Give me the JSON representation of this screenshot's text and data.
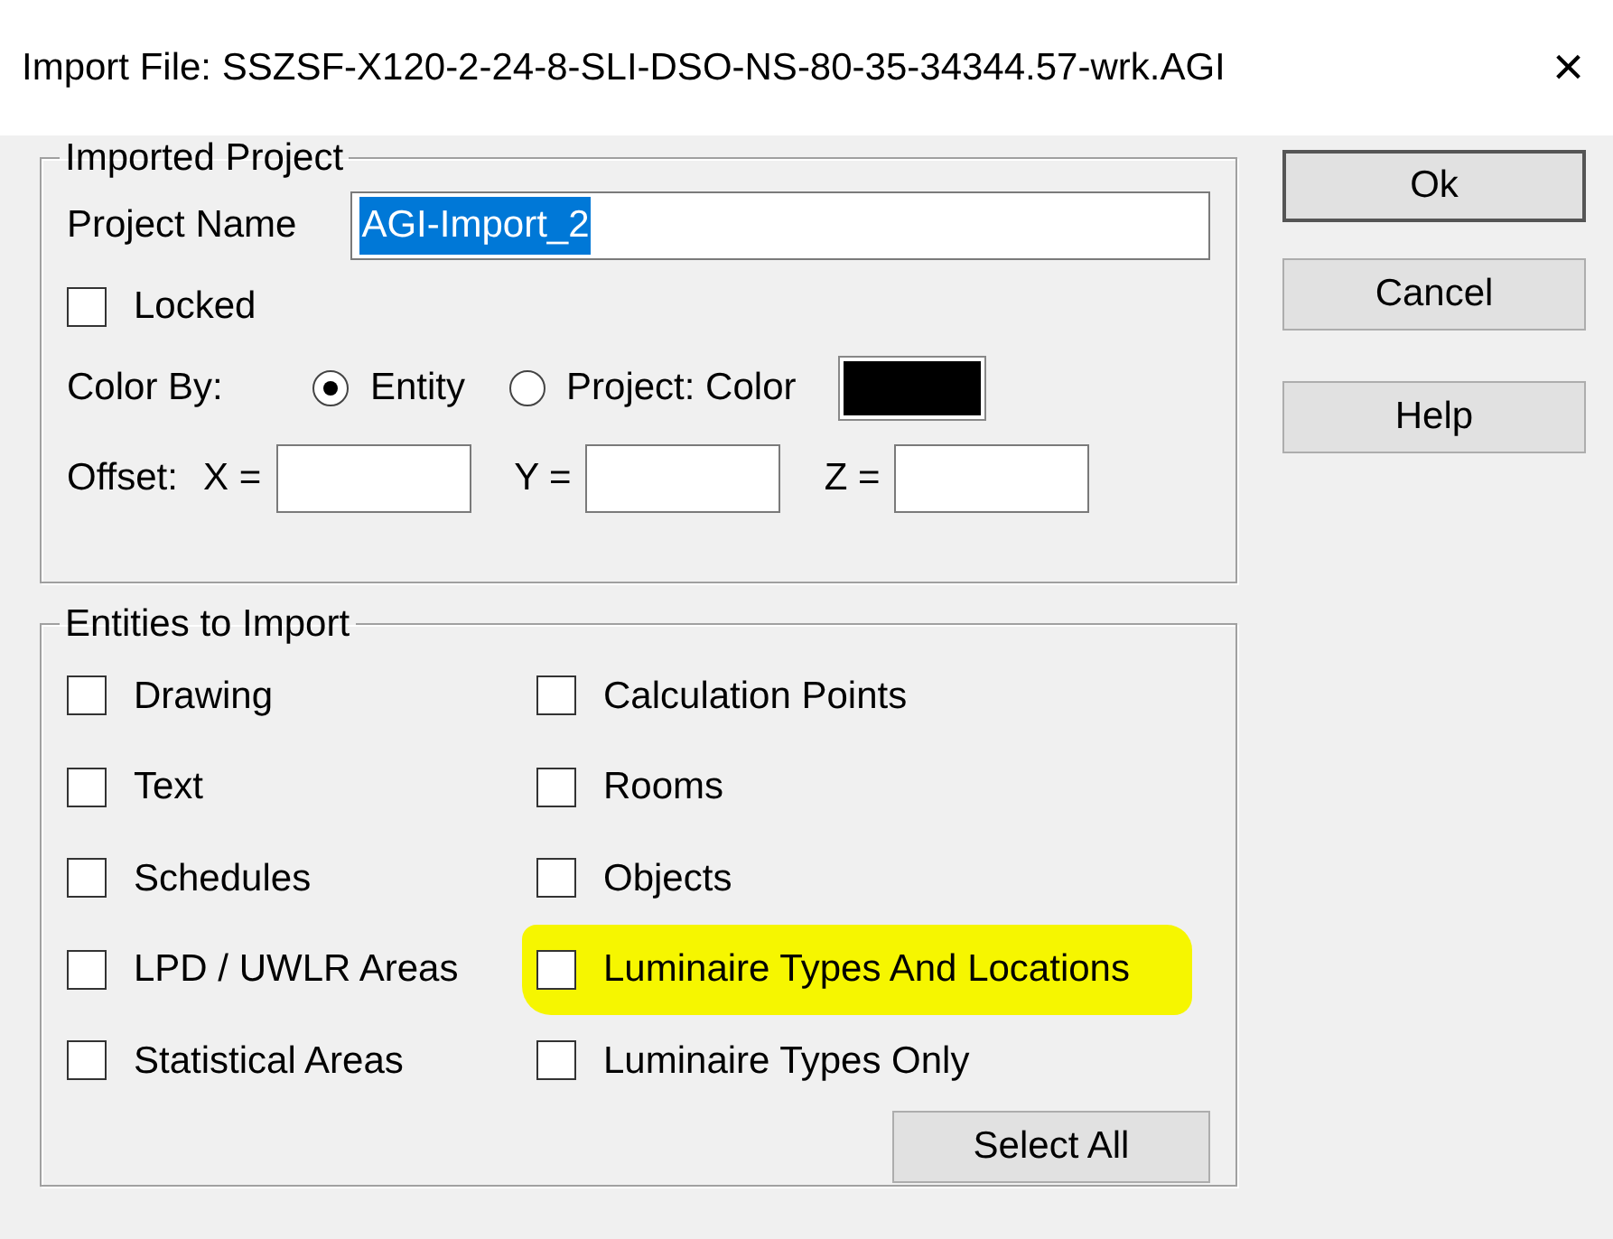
{
  "window": {
    "title": "Import File: SSZSF-X120-2-24-8-SLI-DSO-NS-80-35-34344.57-wrk.AGI",
    "close": "×"
  },
  "imported_project": {
    "title": "Imported Project",
    "project_name_label": "Project Name",
    "project_name": "AGI-Import_2",
    "text_selected": true,
    "locked": {
      "label": "Locked",
      "checked": false
    },
    "color_by": {
      "label": "Color By:",
      "options": [
        {
          "label": "Entity",
          "selected": true
        },
        {
          "label": "Project: Color",
          "selected": false
        }
      ],
      "color": "#000000"
    },
    "offset": {
      "label": "Offset:",
      "fields": [
        {
          "label": "X ="
        },
        {
          "label": "Y ="
        },
        {
          "label": "Z ="
        }
      ]
    }
  },
  "entities": {
    "title": "Entities to Import",
    "items": [
      {
        "label": "Drawing",
        "checked": false,
        "highlighted": false
      },
      {
        "label": "Calculation Points",
        "checked": false,
        "highlighted": false
      },
      {
        "label": "Text",
        "checked": false,
        "highlighted": false
      },
      {
        "label": "Rooms",
        "checked": false,
        "highlighted": false
      },
      {
        "label": "Schedules",
        "checked": false,
        "highlighted": false
      },
      {
        "label": "Objects",
        "checked": false,
        "highlighted": false
      },
      {
        "label": "LPD / UWLR Areas",
        "checked": false,
        "highlighted": false
      },
      {
        "label": "Luminaire Types And Locations",
        "checked": false,
        "highlighted": true
      },
      {
        "label": "Statistical Areas",
        "checked": false,
        "highlighted": false
      },
      {
        "label": "Luminaire Types Only",
        "checked": false,
        "highlighted": false
      }
    ],
    "select_all": "Select All"
  },
  "buttons": [
    {
      "label": "Ok",
      "default": true
    },
    {
      "label": "Cancel",
      "default": false
    },
    {
      "label": "Help",
      "default": false
    }
  ]
}
